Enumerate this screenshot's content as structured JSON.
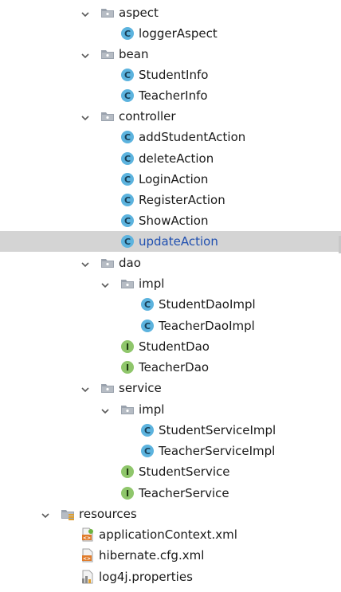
{
  "tree": {
    "items": [
      {
        "label": "aspect",
        "kind": "package",
        "icon": "folder-package-icon",
        "expanded": true
      },
      {
        "label": "loggerAspect",
        "kind": "class",
        "icon": "class-icon"
      },
      {
        "label": "bean",
        "kind": "package",
        "icon": "folder-package-icon",
        "expanded": true
      },
      {
        "label": "StudentInfo",
        "kind": "class",
        "icon": "class-icon"
      },
      {
        "label": "TeacherInfo",
        "kind": "class",
        "icon": "class-icon"
      },
      {
        "label": "controller",
        "kind": "package",
        "icon": "folder-package-icon",
        "expanded": true
      },
      {
        "label": "addStudentAction",
        "kind": "class",
        "icon": "class-icon"
      },
      {
        "label": "deleteAction",
        "kind": "class",
        "icon": "class-icon"
      },
      {
        "label": "LoginAction",
        "kind": "class",
        "icon": "class-icon"
      },
      {
        "label": "RegisterAction",
        "kind": "class",
        "icon": "class-icon"
      },
      {
        "label": "ShowAction",
        "kind": "class",
        "icon": "class-icon"
      },
      {
        "label": "updateAction",
        "kind": "class",
        "icon": "class-icon",
        "selected": true
      },
      {
        "label": "dao",
        "kind": "package",
        "icon": "folder-package-icon",
        "expanded": true
      },
      {
        "label": "impl",
        "kind": "package",
        "icon": "folder-package-icon",
        "expanded": true
      },
      {
        "label": "StudentDaoImpl",
        "kind": "class",
        "icon": "class-icon"
      },
      {
        "label": "TeacherDaoImpl",
        "kind": "class",
        "icon": "class-icon"
      },
      {
        "label": "StudentDao",
        "kind": "interface",
        "icon": "interface-icon"
      },
      {
        "label": "TeacherDao",
        "kind": "interface",
        "icon": "interface-icon"
      },
      {
        "label": "service",
        "kind": "package",
        "icon": "folder-package-icon",
        "expanded": true
      },
      {
        "label": "impl",
        "kind": "package",
        "icon": "folder-package-icon",
        "expanded": true
      },
      {
        "label": "StudentServiceImpl",
        "kind": "class",
        "icon": "class-icon"
      },
      {
        "label": "TeacherServiceImpl",
        "kind": "class",
        "icon": "class-icon"
      },
      {
        "label": "StudentService",
        "kind": "interface",
        "icon": "interface-icon"
      },
      {
        "label": "TeacherService",
        "kind": "interface",
        "icon": "interface-icon"
      },
      {
        "label": "resources",
        "kind": "resource-folder",
        "icon": "resources-folder-icon",
        "expanded": true
      },
      {
        "label": "applicationContext.xml",
        "kind": "spring-xml",
        "icon": "spring-xml-file-icon"
      },
      {
        "label": "hibernate.cfg.xml",
        "kind": "xml",
        "icon": "xml-file-icon"
      },
      {
        "label": "log4j.properties",
        "kind": "properties",
        "icon": "properties-file-icon"
      }
    ]
  },
  "colors": {
    "class_icon_fill": "#5cb3de",
    "class_icon_letter": "#173e57",
    "interface_icon_fill": "#8fc66b",
    "interface_icon_letter": "#1f3a12",
    "folder_icon": "#9aa2ad",
    "arrow": "#5a5a5a",
    "selected_bg": "#d4d4d4",
    "selected_text": "#1f4fb0"
  }
}
